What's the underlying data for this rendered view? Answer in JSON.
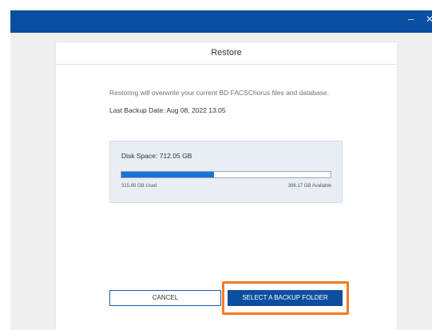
{
  "window": {
    "minimize_glyph": "–",
    "close_glyph": "✕",
    "titlebar_color": "#0a4fa2"
  },
  "dialog": {
    "title": "Restore",
    "warning_text": "Restoring will overwrite your current BD FACSChorus files and database.",
    "last_backup_label": "Last Backup Date: Aug 08, 2022 13:05",
    "disk": {
      "label": "Disk Space: 712.05 GB",
      "used_label": "315.89 GB Used",
      "available_label": "396.17 GB Available",
      "used_gb": 315.89,
      "available_gb": 396.17,
      "total_gb": 712.05,
      "used_fraction": 0.4436,
      "fill_color": "#1674d8"
    },
    "cancel_label": "CANCEL",
    "select_label": "SELECT A BACKUP FOLDER",
    "highlight_color": "#f47a1f",
    "primary_color": "#0c4fa0"
  }
}
